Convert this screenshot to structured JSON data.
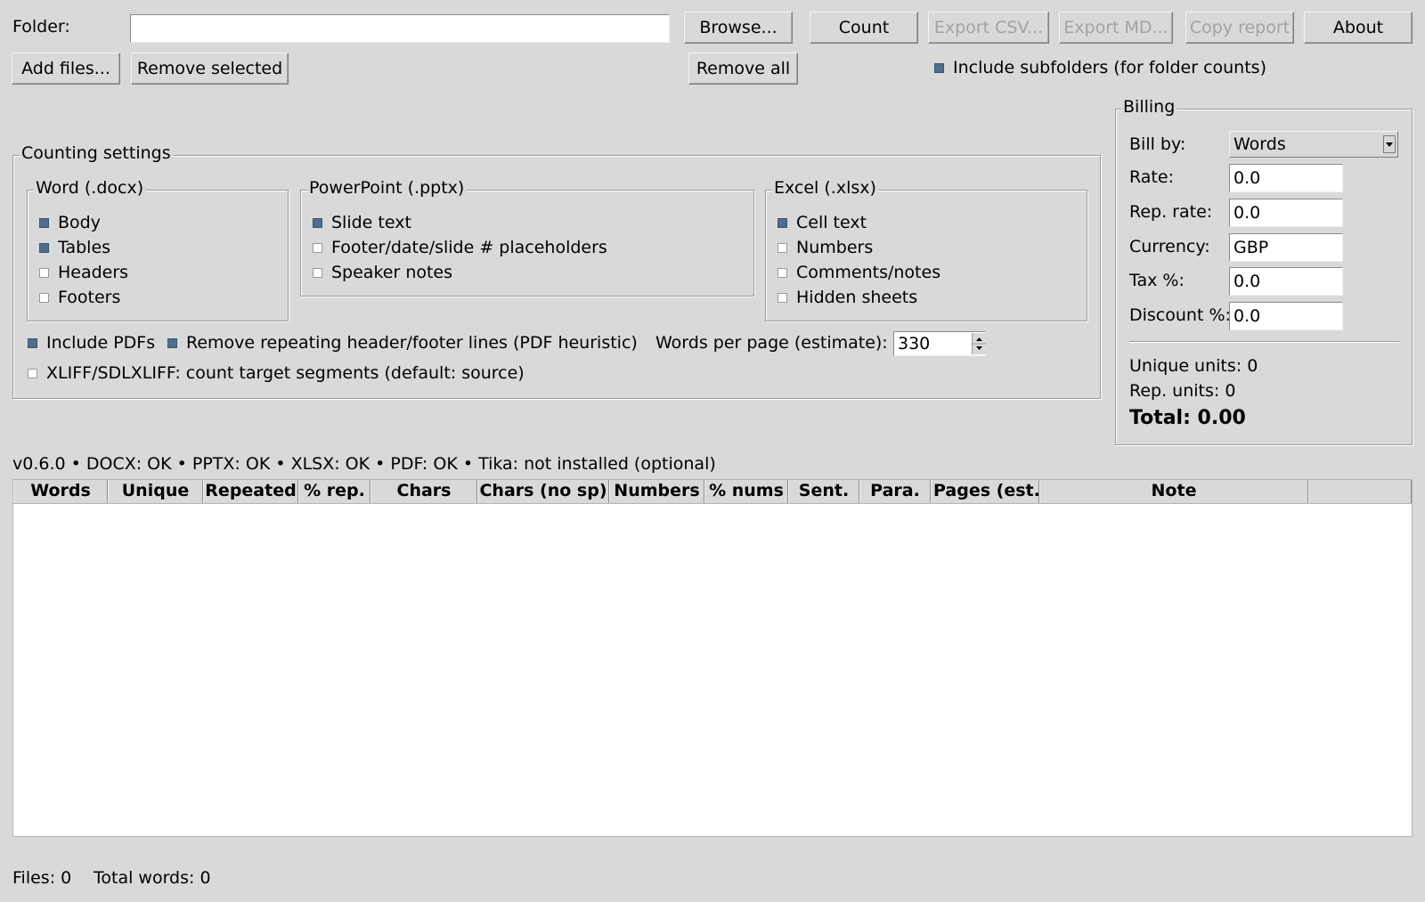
{
  "top": {
    "folder_label": "Folder:",
    "folder_value": "",
    "browse": "Browse...",
    "count": "Count",
    "export_csv": "Export CSV...",
    "export_md": "Export MD...",
    "copy_report": "Copy report",
    "about": "About",
    "add_files": "Add files...",
    "remove_selected": "Remove selected",
    "remove_all": "Remove all",
    "include_subfolders": "Include subfolders (for folder counts)",
    "include_subfolders_checked": true
  },
  "counting": {
    "title": "Counting settings",
    "word": {
      "title": "Word (.docx)",
      "options": [
        {
          "label": "Body",
          "checked": true
        },
        {
          "label": "Tables",
          "checked": true
        },
        {
          "label": "Headers",
          "checked": false
        },
        {
          "label": "Footers",
          "checked": false
        }
      ]
    },
    "powerpoint": {
      "title": "PowerPoint (.pptx)",
      "options": [
        {
          "label": "Slide text",
          "checked": true
        },
        {
          "label": "Footer/date/slide # placeholders",
          "checked": false
        },
        {
          "label": "Speaker notes",
          "checked": false
        }
      ]
    },
    "excel": {
      "title": "Excel (.xlsx)",
      "options": [
        {
          "label": "Cell text",
          "checked": true
        },
        {
          "label": "Numbers",
          "checked": false
        },
        {
          "label": "Comments/notes",
          "checked": false
        },
        {
          "label": "Hidden sheets",
          "checked": false
        }
      ]
    },
    "include_pdfs": "Include PDFs",
    "remove_repeating": "Remove repeating header/footer lines (PDF heuristic)",
    "words_per_page_label": "Words per page (estimate):",
    "words_per_page_value": "330",
    "xliff": "XLIFF/SDLXLIFF: count target segments (default: source)"
  },
  "billing": {
    "title": "Billing",
    "bill_by_label": "Bill by:",
    "bill_by_value": "Words",
    "rate_label": "Rate:",
    "rate_value": "0.0",
    "rep_rate_label": "Rep. rate:",
    "rep_rate_value": "0.0",
    "currency_label": "Currency:",
    "currency_value": "GBP",
    "tax_label": "Tax %:",
    "tax_value": "0.0",
    "discount_label": "Discount %:",
    "discount_value": "0.0",
    "unique_units": "Unique units: 0",
    "rep_units": "Rep. units: 0",
    "total": "Total: 0.00"
  },
  "status_line": "v0.6.0 • DOCX: OK • PPTX: OK • XLSX: OK • PDF: OK • Tika: not installed (optional)",
  "table": {
    "columns": [
      "Words",
      "Unique",
      "Repeated",
      "% rep.",
      "Chars",
      "Chars (no sp)",
      "Numbers",
      "% nums",
      "Sent.",
      "Para.",
      "Pages (est.)",
      "Note"
    ],
    "rows": []
  },
  "footer": {
    "files": "Files: 0",
    "total_words": "Total words: 0"
  },
  "colors": {
    "window_bg": "#d9d9d9",
    "check_on": "#4f6d8c",
    "entry_bg": "#ffffff",
    "disabled_text": "#a3a3a3"
  }
}
